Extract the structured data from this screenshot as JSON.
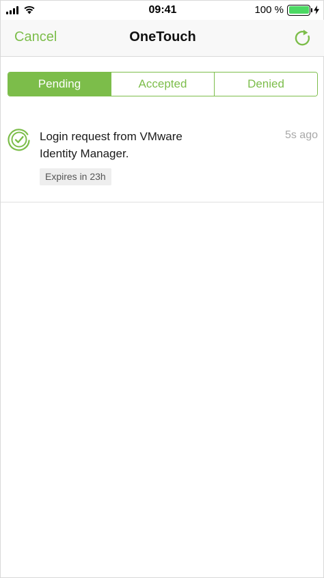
{
  "status_bar": {
    "time": "09:41",
    "battery_percent": "100 %",
    "battery_level": 1.0,
    "signal_icon": "cellular-signal-icon",
    "wifi_icon": "wifi-icon",
    "charging_icon": "charging-bolt-icon"
  },
  "nav": {
    "cancel_label": "Cancel",
    "title": "OneTouch",
    "refresh_icon": "refresh-icon"
  },
  "tabs": [
    {
      "label": "Pending",
      "active": true
    },
    {
      "label": "Accepted",
      "active": false
    },
    {
      "label": "Denied",
      "active": false
    }
  ],
  "requests": [
    {
      "icon": "approved-check-icon",
      "message": "Login request from VMware Identity Manager.",
      "time": "5s ago",
      "expires": "Expires in 23h"
    }
  ],
  "colors": {
    "accent": "#7cbd4a",
    "battery": "#4cd964",
    "muted_text": "#a8a8a8"
  }
}
